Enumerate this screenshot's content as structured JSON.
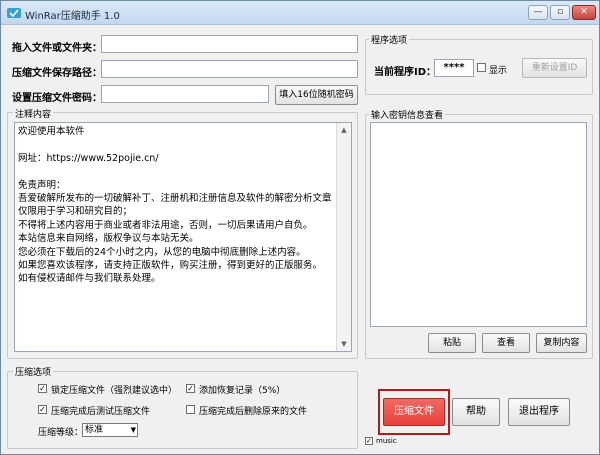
{
  "window": {
    "title": "WinRar压缩助手 1.0",
    "minimize": "—",
    "maximize": "▫",
    "close": "✕"
  },
  "form": {
    "drag_label": "拖入文件或文件夹：",
    "drag_value": "",
    "save_path_label": "压缩文件保存路径：",
    "save_path_value": "",
    "password_label": "设置压缩文件密码：",
    "password_value": "",
    "random_password_button": "填入16位随机密码"
  },
  "program_options": {
    "title": "程序选项",
    "current_id_label": "当前程序ID：",
    "current_id_value": "****",
    "show_label": "显示",
    "show_checked": false,
    "reset_id_button": "重新设置ID"
  },
  "notes": {
    "title": "注释内容",
    "lines": [
      "欢迎使用本软件",
      "",
      "网址：https://www.52pojie.cn/",
      "",
      "免责声明：",
      "吾爱破解所发布的一切破解补丁、注册机和注册信息及软件的解密分析文章",
      "仅限用于学习和研究目的；",
      "不得将上述内容用于商业或者非法用途，否则，一切后果请用户自负。",
      "本站信息来自网络，版权争议与本站无关。",
      "您必须在下载后的24个小时之内，从您的电脑中彻底删除上述内容。",
      "如果您喜欢该程序，请支持正版软件，购买注册，得到更好的正版服务。",
      "如有侵权请邮件与我们联系处理。"
    ]
  },
  "key_info": {
    "title": "输入密钥信息查看",
    "content": "",
    "paste_button": "粘贴",
    "view_button": "查看",
    "copy_button": "复制内容"
  },
  "compress_options": {
    "title": "压缩选项",
    "lock_label": "锁定压缩文件（强烈建议选中）",
    "lock_checked": true,
    "recovery_label": "添加恢复记录（5%）",
    "recovery_checked": true,
    "test_label": "压缩完成后测试压缩文件",
    "test_checked": true,
    "delete_label": "压缩完成后删除原来的文件",
    "delete_checked": false,
    "level_label": "压缩等级：",
    "level_value": "标准"
  },
  "actions": {
    "compress_button": "压缩文件",
    "help_button": "帮助",
    "exit_button": "退出程序",
    "music_label": "music",
    "music_checked": true
  },
  "colors": {
    "compress_button_bg": "#e8413b",
    "highlight_border": "#b31b1b",
    "titlebar": "#c2d7ef"
  }
}
